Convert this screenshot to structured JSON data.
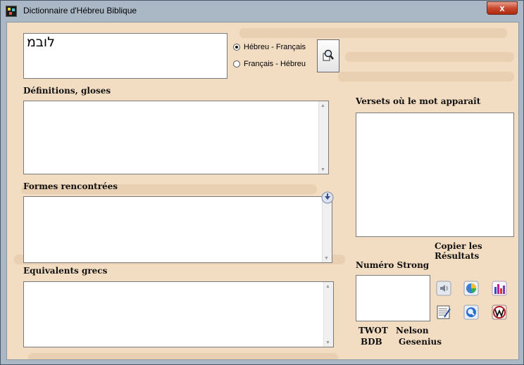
{
  "window": {
    "title": "Dictionnaire d'Hébreu Biblique",
    "close_label": "x"
  },
  "search": {
    "query": "לובמ"
  },
  "direction": {
    "options": [
      {
        "label": "Hébreu - Français",
        "selected": true
      },
      {
        "label": "Français - Hébreu",
        "selected": false
      }
    ]
  },
  "sections": {
    "definitions_label": "Définitions, gloses",
    "forms_label": "Formes rencontrées",
    "greek_label": "Equivalents grecs",
    "verses_label": "Versets où le mot apparaît",
    "copy_results_label": "Copier les Résultats",
    "strong_label": "Numéro Strong"
  },
  "references": {
    "twot": "TWOT",
    "nelson": "Nelson",
    "bdb": "BDB",
    "gesenius": "Gesenius"
  },
  "icons": [
    "search-button-icon",
    "speaker-icon",
    "pie-chart-icon",
    "bar-chart-icon",
    "notes-icon",
    "zoom-icon",
    "wiki-icon",
    "down-arrow-icon"
  ],
  "colors": {
    "parchment": "#f3ddc2",
    "close_red": "#c84a30"
  }
}
